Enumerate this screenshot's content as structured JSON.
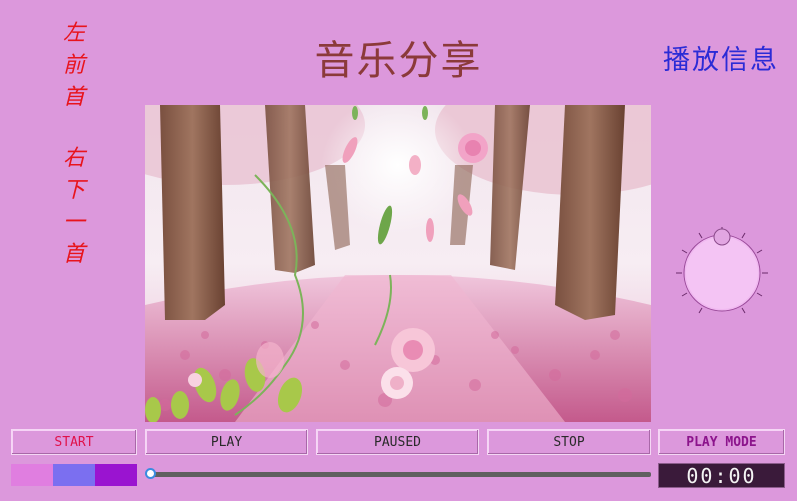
{
  "sidebar": {
    "prev_label": "左前首",
    "next_label": "右下一首"
  },
  "header": {
    "title": "音乐分享",
    "info_label": "播放信息"
  },
  "artwork": {
    "description_icon": "cherry-blossom-path-artwork"
  },
  "volume_knob": {
    "icon": "volume-knob-icon"
  },
  "controls": {
    "start_label": "START",
    "play_label": "PLAY",
    "paused_label": "PAUSED",
    "stop_label": "STOP",
    "mode_label": "PLAY MODE"
  },
  "theme_swatches": [
    {
      "color": "#e07ee0"
    },
    {
      "color": "#7b6ff0"
    },
    {
      "color": "#9a14d0"
    }
  ],
  "progress": {
    "fraction": 0.0
  },
  "time": {
    "display": "00:00"
  },
  "colors": {
    "background": "#dc98dc",
    "title": "#8b3a3a",
    "info": "#2b2bd6",
    "side_text": "#e8141c",
    "start_text": "#e0114a",
    "mode_text": "#8c148c"
  }
}
